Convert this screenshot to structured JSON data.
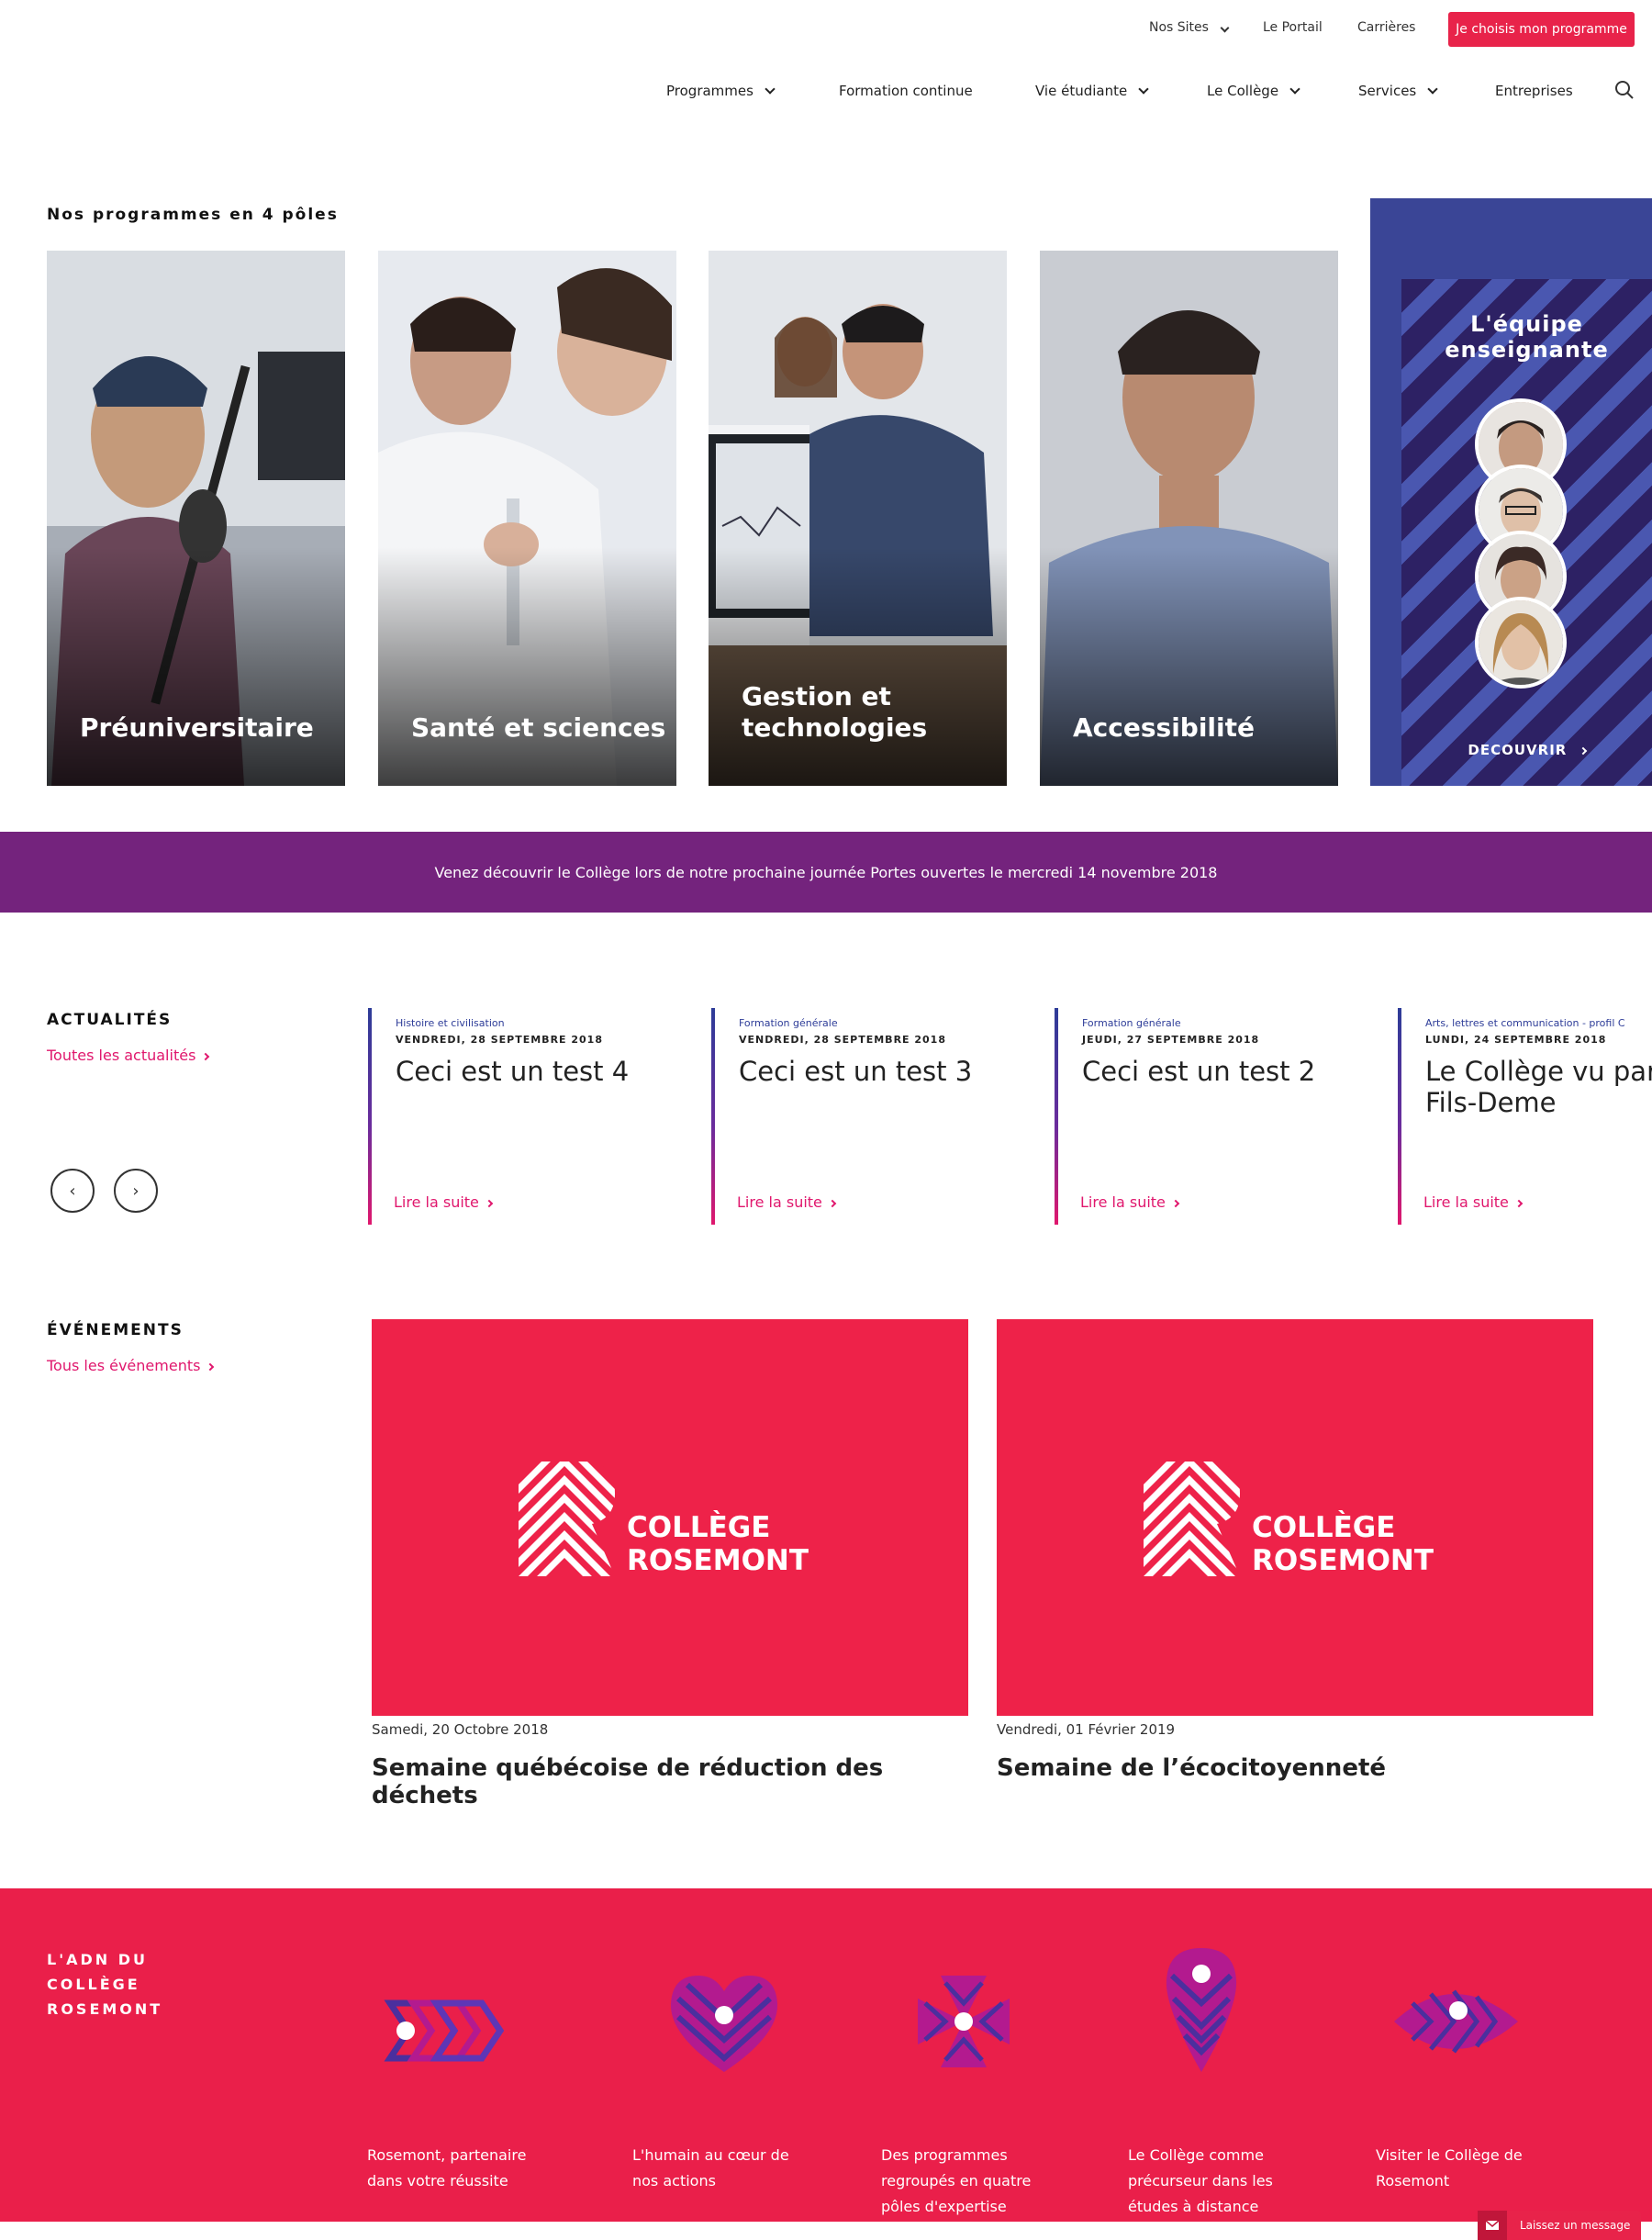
{
  "topbar": {
    "nos_sites": "Nos Sites",
    "portail": "Le Portail",
    "carrieres": "Carrières",
    "cta": "Je choisis mon programme"
  },
  "nav": {
    "items": [
      {
        "label": "Programmes",
        "dropdown": true
      },
      {
        "label": "Formation continue",
        "dropdown": false
      },
      {
        "label": "Vie étudiante",
        "dropdown": true
      },
      {
        "label": "Le Collège",
        "dropdown": true
      },
      {
        "label": "Services",
        "dropdown": true
      },
      {
        "label": "Entreprises",
        "dropdown": false
      }
    ]
  },
  "programs": {
    "title": "Nos programmes en 4 pôles",
    "cards": [
      {
        "label": "Préuniversitaire"
      },
      {
        "label": "Santé et sciences"
      },
      {
        "label": "Gestion et technologies"
      },
      {
        "label": "Accessibilité"
      }
    ],
    "team": {
      "title": "L'équipe enseignante",
      "cta": "DECOUVRIR"
    }
  },
  "banner": {
    "text": "Venez découvrir le Collège lors de notre prochaine journée Portes ouvertes le mercredi 14 novembre 2018"
  },
  "news": {
    "heading": "ACTUALITÉS",
    "all_link": "Toutes les actualités",
    "read_more": "Lire la suite",
    "items": [
      {
        "category": "Histoire et civilisation",
        "date": "VENDREDI, 28 SEPTEMBRE 2018",
        "title": "Ceci est un test 4"
      },
      {
        "category": "Formation générale",
        "date": "VENDREDI, 28 SEPTEMBRE 2018",
        "title": "Ceci est un test 3"
      },
      {
        "category": "Formation générale",
        "date": "JEUDI, 27 SEPTEMBRE 2018",
        "title": "Ceci est un test 2"
      },
      {
        "category": "Arts, lettres et communication - profil C",
        "date": "LUNDI, 24 SEPTEMBRE 2018",
        "title": "Le Collège vu par Tracey Fils-Deme"
      }
    ]
  },
  "events": {
    "heading": "ÉVÉNEMENTS",
    "all_link": "Tous les événements",
    "logo_line1": "COLLÈGE",
    "logo_line2": "ROSEMONT",
    "items": [
      {
        "date": "Samedi, 20 Octobre 2018",
        "title": "Semaine québécoise de réduction des déchets"
      },
      {
        "date": "Vendredi, 01 Février 2019",
        "title": "Semaine de l’écocitoyenneté"
      }
    ]
  },
  "adn": {
    "title_line1": "L'ADN DU",
    "title_line2": "COLLÈGE",
    "title_line3": "ROSEMONT",
    "items": [
      {
        "text": "Rosemont, partenaire dans votre réussite"
      },
      {
        "text": "L'humain au cœur de nos actions"
      },
      {
        "text": "Des programmes regroupés en quatre pôles d'expertise"
      },
      {
        "text": "Le Collège comme précurseur dans les études à distance"
      },
      {
        "text": "Visiter le Collège de Rosemont"
      }
    ]
  },
  "message_button": "Laissez un message",
  "colors": {
    "brand_red": "#e8234a",
    "purple": "#74237d",
    "navy": "#3a4596",
    "link_pink": "#e0176d"
  }
}
